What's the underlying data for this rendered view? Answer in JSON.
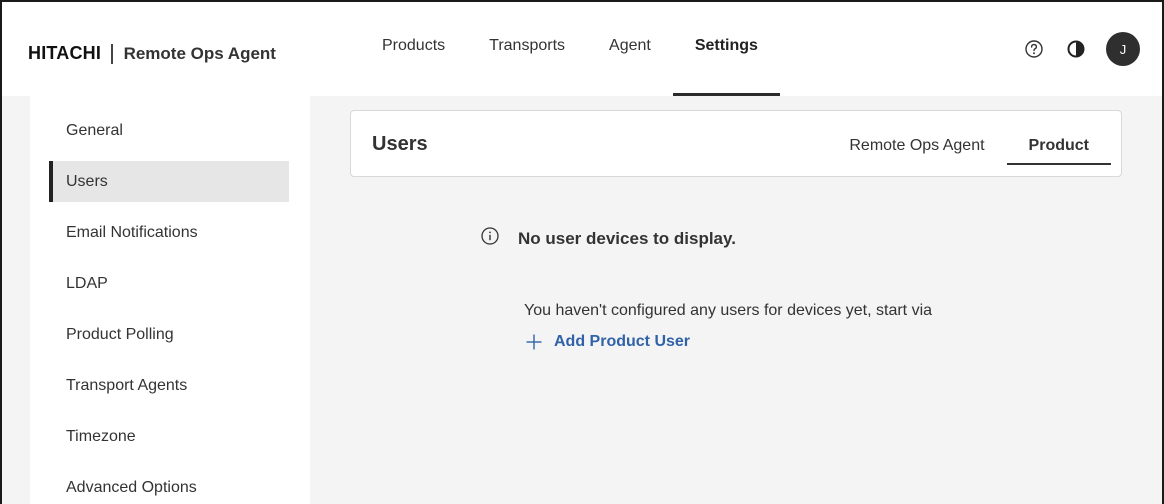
{
  "header": {
    "brand_logo": "HITACHI",
    "brand_name": "Remote Ops Agent",
    "nav": [
      {
        "label": "Products"
      },
      {
        "label": "Transports"
      },
      {
        "label": "Agent"
      },
      {
        "label": "Settings"
      }
    ],
    "active_nav": "Settings",
    "help_icon": "help-circle-icon",
    "theme_icon": "contrast-icon",
    "avatar_initial": "J"
  },
  "sidebar": {
    "items": [
      {
        "label": "General"
      },
      {
        "label": "Users"
      },
      {
        "label": "Email Notifications"
      },
      {
        "label": "LDAP"
      },
      {
        "label": "Product Polling"
      },
      {
        "label": "Transport Agents"
      },
      {
        "label": "Timezone"
      },
      {
        "label": "Advanced Options"
      }
    ],
    "active_item": "Users"
  },
  "main": {
    "title": "Users",
    "tabs": [
      {
        "label": "Remote Ops Agent"
      },
      {
        "label": "Product"
      }
    ],
    "active_tab": "Product",
    "empty_state": {
      "icon": "info-icon",
      "title": "No user devices to display.",
      "message": "You haven't configured any users for devices yet, start via",
      "action_label": "Add Product User",
      "action_icon": "plus-icon"
    }
  },
  "colors": {
    "accent": "#2f62a8",
    "active_underline": "#2b2b2b",
    "background": "#f4f4f4",
    "avatar_bg": "#2f2f2f"
  }
}
